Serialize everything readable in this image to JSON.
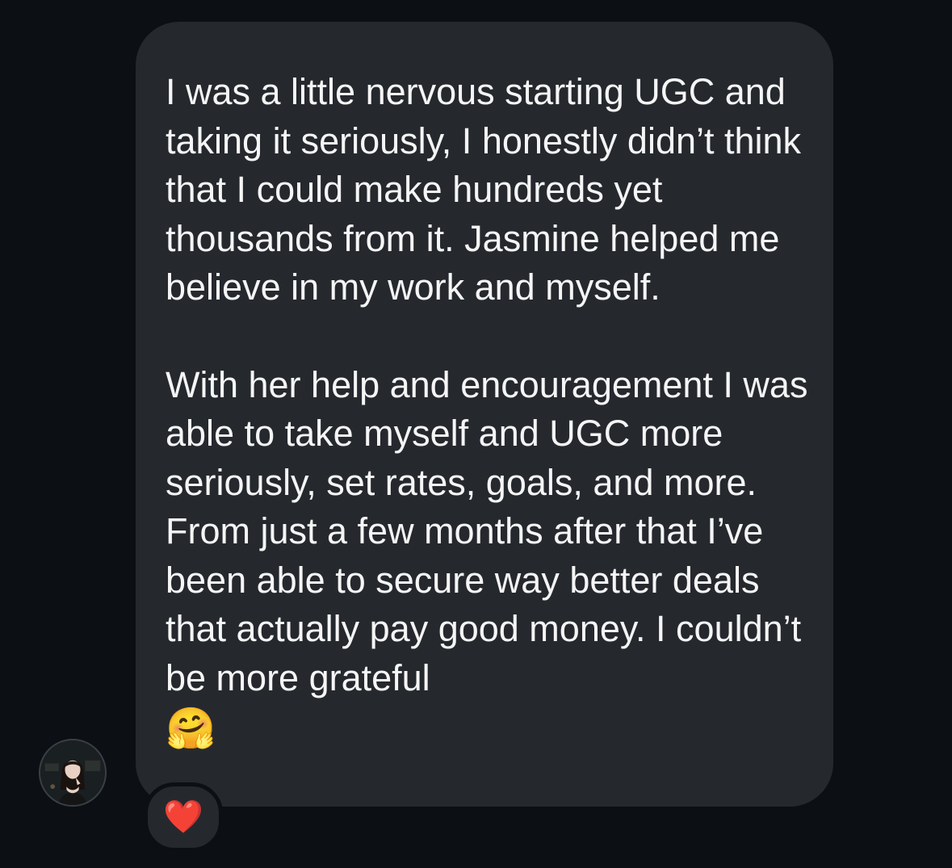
{
  "message": {
    "paragraph_1": "I was a little nervous starting UGC and taking it seriously, I honestly didn’t think that I could make hundreds yet thousands from it. Jasmine helped me believe in my work and myself.",
    "paragraph_2": "With her help and encouragement I was able to take myself and UGC more seriously, set rates, goals, and more. From just a few months after that I’ve been able to secure way better deals that actually pay good money. I couldn’t be more grateful",
    "emoji": "🤗"
  },
  "reaction": {
    "emoji": "❤️"
  },
  "sender": {
    "avatar_icon": "profile-photo"
  },
  "colors": {
    "background": "#0c1014",
    "bubble": "#25292e",
    "text": "#f5f5f5"
  }
}
